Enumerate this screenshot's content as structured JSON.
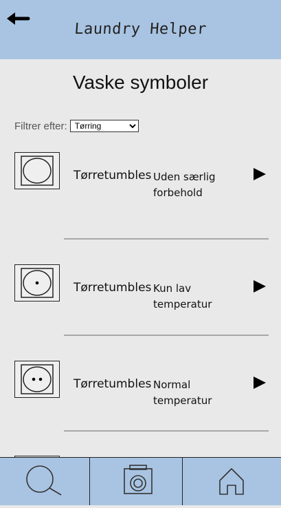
{
  "header": {
    "title": "Laundry Helper",
    "back_icon": "arrow-left-icon"
  },
  "page": {
    "title": "Vaske symboler"
  },
  "filter": {
    "label": "Filtrer efter:",
    "selected": "Tørring"
  },
  "symbols": [
    {
      "name": "Tørretumbles",
      "description": "Uden særlig forbehold",
      "dots": 0
    },
    {
      "name": "Tørretumbles",
      "description": "Kun lav temperatur",
      "dots": 1
    },
    {
      "name": "Tørretumbles",
      "description": "Normal temperatur",
      "dots": 2
    }
  ],
  "nav": {
    "tabs": [
      "search-icon",
      "camera-icon",
      "home-icon"
    ]
  },
  "colors": {
    "header_bg": "#a9c4e2",
    "page_bg": "#e9e9e9"
  }
}
